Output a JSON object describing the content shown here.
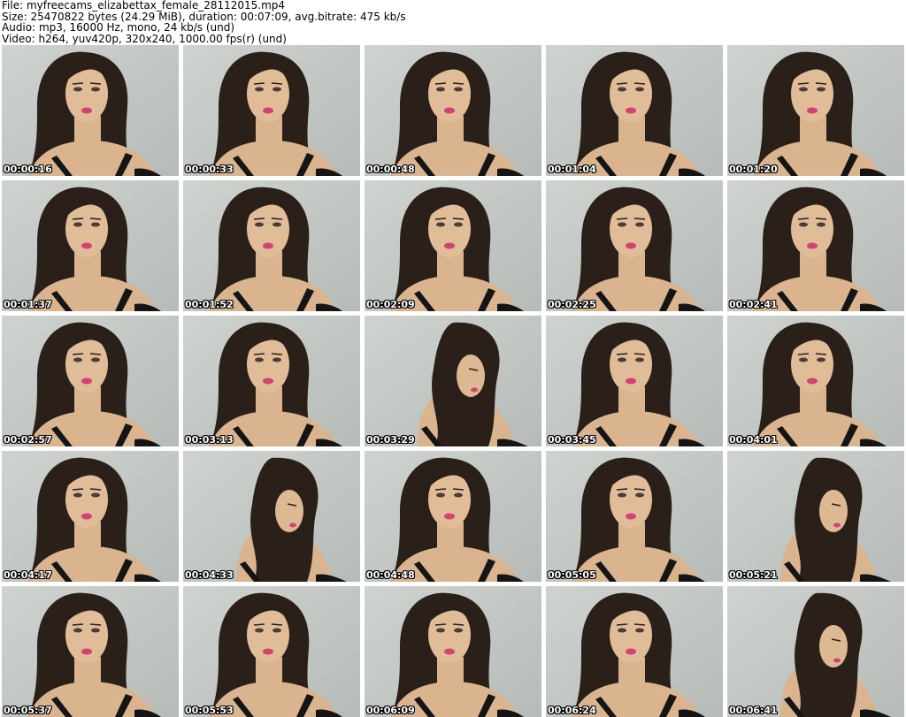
{
  "header": {
    "file": "File: myfreecams_elizabettax_female_28112015.mp4",
    "size": "Size: 25470822 bytes (24.29 MiB), duration: 00:07:09, avg.bitrate: 475 kb/s",
    "audio": "Audio: mp3, 16000 Hz, mono, 24 kb/s (und)",
    "video": "Video: h264, yuv420p, 320x240, 1000.00 fps(r) (und)"
  },
  "thumbnails": [
    {
      "time": "00:00:16",
      "pose": "front"
    },
    {
      "time": "00:00:33",
      "pose": "front"
    },
    {
      "time": "00:00:48",
      "pose": "front"
    },
    {
      "time": "00:01:04",
      "pose": "front"
    },
    {
      "time": "00:01:20",
      "pose": "front"
    },
    {
      "time": "00:01:37",
      "pose": "front"
    },
    {
      "time": "00:01:52",
      "pose": "front"
    },
    {
      "time": "00:02:09",
      "pose": "front"
    },
    {
      "time": "00:02:25",
      "pose": "front"
    },
    {
      "time": "00:02:41",
      "pose": "front"
    },
    {
      "time": "00:02:57",
      "pose": "front"
    },
    {
      "time": "00:03:13",
      "pose": "front"
    },
    {
      "time": "00:03:29",
      "pose": "down"
    },
    {
      "time": "00:03:45",
      "pose": "front"
    },
    {
      "time": "00:04:01",
      "pose": "front"
    },
    {
      "time": "00:04:17",
      "pose": "front"
    },
    {
      "time": "00:04:33",
      "pose": "down"
    },
    {
      "time": "00:04:48",
      "pose": "front"
    },
    {
      "time": "00:05:05",
      "pose": "front"
    },
    {
      "time": "00:05:21",
      "pose": "down"
    },
    {
      "time": "00:05:37",
      "pose": "front"
    },
    {
      "time": "00:05:53",
      "pose": "front"
    },
    {
      "time": "00:06:09",
      "pose": "front"
    },
    {
      "time": "00:06:24",
      "pose": "front"
    },
    {
      "time": "00:06:41",
      "pose": "down"
    }
  ],
  "colors": {
    "wall": "#c3c8c4",
    "hair": "#2b1f1a",
    "skin": "#d9b48e",
    "lips": "#d0456f",
    "top": "#151515"
  }
}
